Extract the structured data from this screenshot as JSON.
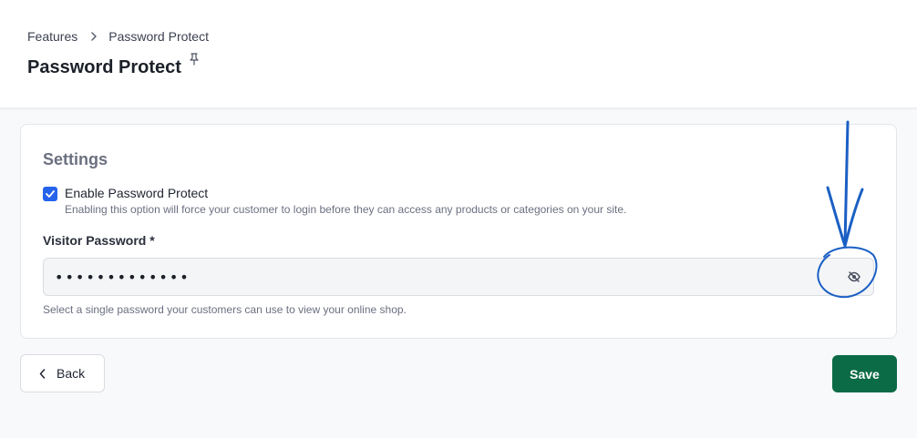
{
  "breadcrumb": {
    "parent": "Features",
    "current": "Password Protect"
  },
  "page": {
    "title": "Password Protect",
    "pin_icon": "pin-icon"
  },
  "settings": {
    "title": "Settings",
    "enable": {
      "label": "Enable Password Protect",
      "checked": true,
      "help": "Enabling this option will force your customer to login before they can access any products or categories on your site."
    },
    "visitor_password": {
      "label": "Visitor Password *",
      "masked_value": "•••••••••••••",
      "help": "Select a single password your customers can use to view your online shop.",
      "toggle_icon": "eye-off-icon"
    }
  },
  "actions": {
    "back_label": "Back",
    "save_label": "Save"
  },
  "colors": {
    "accent": "#2563eb",
    "save": "#0b6b47",
    "annotation": "#1a5fc4"
  }
}
